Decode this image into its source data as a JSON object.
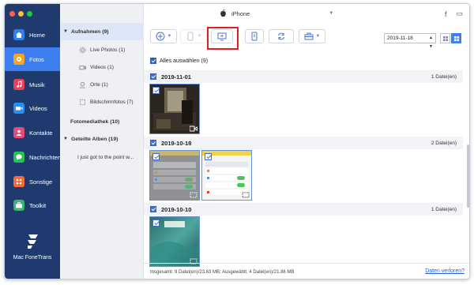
{
  "window": {
    "device_name": "iPhone"
  },
  "nav": {
    "items": [
      {
        "label": "Home",
        "icon": "home-icon",
        "color": "#2f80ed"
      },
      {
        "label": "Fotos",
        "icon": "photos-icon",
        "color": "#f5a623"
      },
      {
        "label": "Musik",
        "icon": "music-icon",
        "color": "#e9435c"
      },
      {
        "label": "Videos",
        "icon": "video-icon",
        "color": "#2d8cf0"
      },
      {
        "label": "Kontakte",
        "icon": "contacts-icon",
        "color": "#e24b7a"
      },
      {
        "label": "Nachrichten",
        "icon": "messages-icon",
        "color": "#2bc053"
      },
      {
        "label": "Sonstige",
        "icon": "other-icon",
        "color": "#f26b3a"
      },
      {
        "label": "Toolkit",
        "icon": "toolkit-icon",
        "color": "#3cb371"
      }
    ],
    "active_index": 1,
    "brand": "Mac FoneTrans"
  },
  "tree": {
    "albums_header": "Aufnahmen (9)",
    "album_items": [
      {
        "label": "Live Photos (1)",
        "icon": "live-photo-icon"
      },
      {
        "label": "Videos (1)",
        "icon": "video-camera-icon"
      },
      {
        "label": "Orte (1)",
        "icon": "location-icon"
      },
      {
        "label": "Bildschirmfotos (7)",
        "icon": "screenshot-icon"
      }
    ],
    "library_header": "Fotomediathek (10)",
    "shared_header": "Geteilte Alben (19)",
    "shared_items": [
      {
        "label": "I just got to the point w..."
      }
    ]
  },
  "toolbar": {
    "date_value": "2019-11-18",
    "buttons": [
      "add-icon",
      "export-device-icon",
      "export-pc-icon",
      "phone-icon",
      "sync-icon",
      "toolbox-icon"
    ],
    "highlighted": "export-pc-icon"
  },
  "content": {
    "select_all": "Alles auswählen (9)",
    "groups": [
      {
        "date": "2019-11-01",
        "count": "1 Datei(en)"
      },
      {
        "date": "2019-10-18",
        "count": "2 Datei(en)"
      },
      {
        "date": "2019-10-10",
        "count": "1 Datei(en)"
      }
    ]
  },
  "status": {
    "summary": "Insgesamt: 9 Datei(en)/23.63 MB; Ausgewählt: 4 Datei(en)/21.86 MB",
    "lost_link": "Daten verloren?"
  },
  "colors": {
    "nav_bg": "#1f3a6e",
    "accent": "#3d7ff0",
    "highlight": "#e02020"
  }
}
